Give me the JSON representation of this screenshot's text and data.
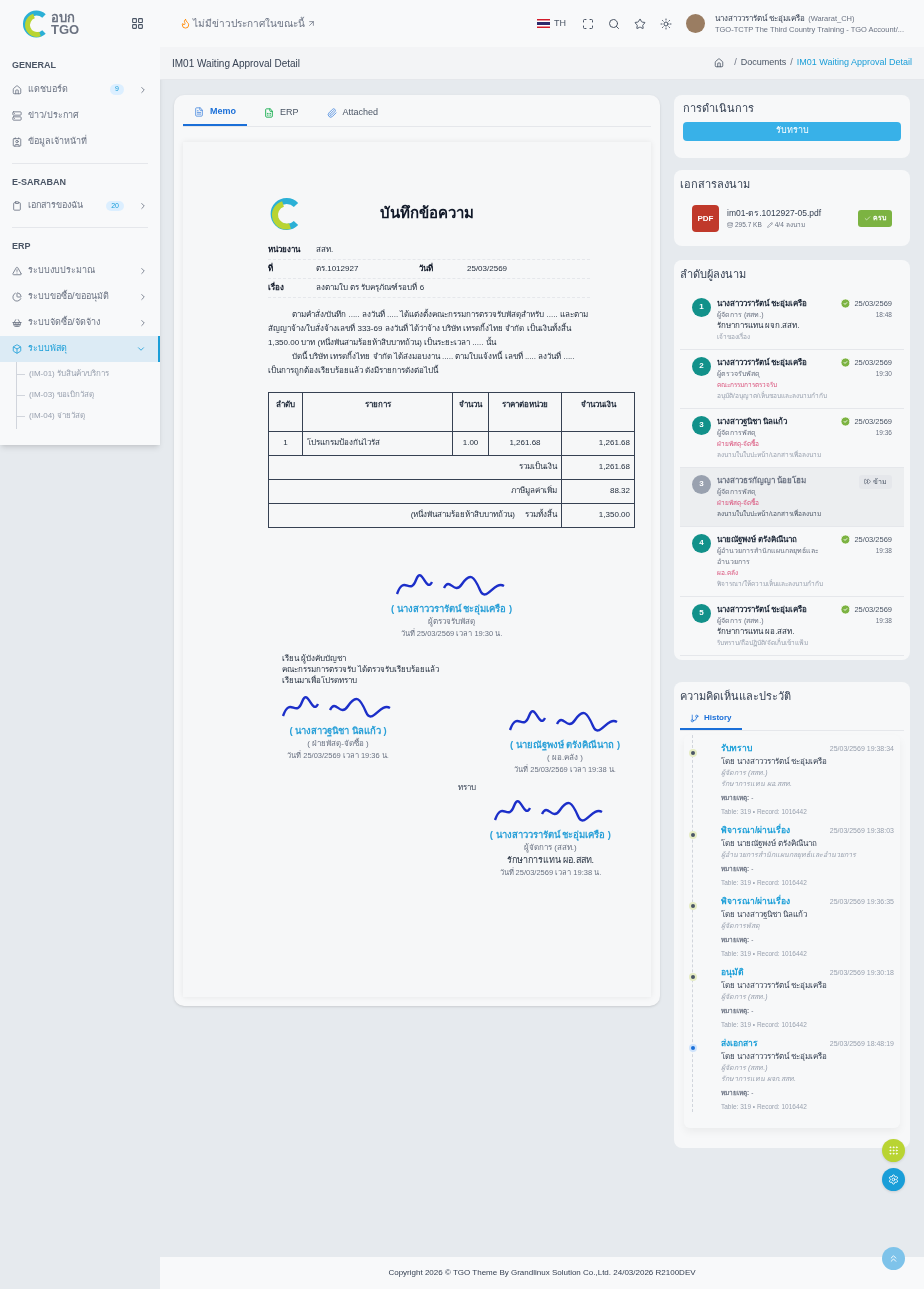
{
  "logo": {
    "line1": "อบก",
    "line2": "TGO"
  },
  "header": {
    "news": "ไม่มีข่าวประกาศในขณะนี้",
    "language": "TH",
    "user": {
      "name": "นางสาววรารัตน์ ชะอุ่มเครือ",
      "username": "(Wararat_CH)",
      "org": "TGO-TCTP The Third Country Training - TGO Account/..."
    }
  },
  "sidebar": {
    "sections": [
      {
        "title": "GENERAL",
        "items": [
          {
            "label": "แดชบอร์ด",
            "badge": "9",
            "expanded": false,
            "selected": false
          },
          {
            "label": "ข่าว/ประกาศ",
            "selected": false
          },
          {
            "label": "ข้อมูลเจ้าหน้าที่",
            "selected": false
          }
        ]
      },
      {
        "title": "E-SARABAN",
        "items": [
          {
            "label": "เอกสารของฉัน",
            "badge": "20",
            "expanded": false,
            "selected": false
          }
        ]
      },
      {
        "title": "ERP",
        "items": [
          {
            "label": "ระบบงบประมาณ",
            "expanded": false,
            "selected": false
          },
          {
            "label": "ระบบขอซื้อ/ขออนุมัติ",
            "expanded": false,
            "selected": false
          },
          {
            "label": "ระบบจัดซื้อ/จัดจ้าง",
            "expanded": false,
            "selected": false
          },
          {
            "label": "ระบบพัสดุ",
            "expanded": true,
            "selected": true,
            "children": [
              {
                "label": "(IM-01) รับสินค้า/บริการ"
              },
              {
                "label": "(IM-03) ขอเบิกวัสดุ"
              },
              {
                "label": "(IM-04) จ่ายวัสดุ"
              }
            ]
          }
        ]
      }
    ]
  },
  "page": {
    "title": "IM01 Waiting Approval Detail",
    "separator": "/",
    "breadcrumb": [
      {
        "label": "Documents",
        "current": false
      },
      {
        "label": "IM01 Waiting Approval Detail",
        "current": true
      }
    ]
  },
  "tabs": [
    {
      "label": "Memo",
      "selected": true
    },
    {
      "label": "ERP",
      "selected": false
    },
    {
      "label": "Attached",
      "selected": false
    }
  ],
  "memo": {
    "title": "บันทึกข้อความ",
    "fields": [
      {
        "label": "หน่วยงาน",
        "value": "สสท."
      },
      {
        "label": "ที่",
        "value": "ตร.1012927",
        "label2": "วันที่",
        "value2": "25/03/2569"
      },
      {
        "label": "เรื่อง",
        "value": "ลงตามใบ ตร รับครุภัณฑ์รอบที่ 6"
      }
    ],
    "paragraphs": [
      "ตามคำสั่ง/บันทึก ..... ลงวันที่ ..... ได้แต่งตั้งคณะกรรมการตรวจรับพัสดุสำหรับ ..... และตามสัญญาจ้าง/ใบสั่งจ้างเลขที่ 333-69 ลงวันที่ ได้ว่าจ้าง บริษัท เทรดกิ้งไทย จำกัด เป็นเงินทั้งสิ้น 1,350.00 บาท (หนึ่งพันสามร้อยห้าสิบบาทถ้วน) เป็นระยะเวลา ..... นั้น",
      "บัดนี้ บริษัท เทรดกิ้งไทย จำกัด ได้ส่งมอบงาน ..... ตามใบแจ้งหนี้ เลขที่ ..... ลงวันที่ ..... เป็นการถูกต้องเรียบร้อยแล้ว ดังมีรายการดังต่อไปนี้"
    ],
    "table": {
      "columns": [
        "ลำดับ",
        "รายการ",
        "จำนวน",
        "ราคาต่อหน่วย",
        "จำนวนเงิน"
      ],
      "rows": [
        [
          "1",
          "โปรแกรมป้องกันไวรัส",
          "1.00",
          "1,261.68",
          "1,261.68"
        ]
      ],
      "totals": [
        {
          "label": "รวมเป็นเงิน",
          "value": "1,261.68"
        },
        {
          "label": "ภาษีมูลค่าเพิ่ม",
          "value": "88.32"
        },
        {
          "words": "(หนึ่งพันสามร้อยห้าสิบบาทถ้วน)",
          "label": "รวมทั้งสิ้น",
          "value": "1,350.00"
        }
      ]
    },
    "signature1": {
      "name": "( นางสาววรารัตน์ ชะอุ่มเครือ )",
      "role": "ผู้ตรวจรับพัสดุ",
      "date": "วันที่ 25/03/2569 เวลา 19:30 น."
    },
    "letter": [
      "เรียน ผู้บังคับบัญชา",
      "คณะกรรมการตรวจรับ ได้ตรวจรับเรียบร้อยแล้ว",
      "เรียนมาเพื่อโปรดทราบ"
    ],
    "signature2": {
      "name": "( นางสาวฐนิชา นิลแก้ว )",
      "role": "( ฝ่ายพัสดุ-จัดซื้อ )",
      "date": "วันที่ 25/03/2569 เวลา 19:36 น."
    },
    "signature3": {
      "name": "( นายณัฐพงษ์ ตรังคิณีนาถ )",
      "role": "( ผอ.คลัง )",
      "date": "วันที่ 25/03/2569 เวลา 19:38 น."
    },
    "acknowledge": "ทราบ",
    "signature4": {
      "name": "( นางสาววรารัตน์ ชะอุ่มเครือ )",
      "role": "ผู้จัดการ (สสท.)",
      "acting": "รักษาการแทน ผอ.สสท.",
      "date": "วันที่ 25/03/2569 เวลา 19:38 น."
    }
  },
  "actions": {
    "title": "การดำเนินการ",
    "button": "รับทราบ"
  },
  "signed_document": {
    "title": "เอกสารลงนาม",
    "file_type": "PDF",
    "file_name": "im01-ตร.1012927-05.pdf",
    "size": "295.7 KB",
    "signatures": "4/4 ลงนาม",
    "status": "ครบ"
  },
  "signers": {
    "title": "ลำดับผู้ลงนาม",
    "items": [
      {
        "kind": "done",
        "number": "1",
        "name": "นางสาววรารัตน์ ชะอุ่มเครือ",
        "position": "ผู้จัดการ (สสท.)",
        "acting": "รักษาการแทน ผจก.สสท.",
        "duty": "เจ้าของเรื่อง",
        "date": "25/03/2569",
        "time": "18:48"
      },
      {
        "kind": "done",
        "number": "2",
        "name": "นางสาววรารัตน์ ชะอุ่มเครือ",
        "position": "ผู้ตรวจรับพัสดุ",
        "unit": "คณะกรรมการตรวจรับ",
        "duty": "อนุมัติ/อนุญาต/เห็นชอบและลงนามกำกับ",
        "date": "25/03/2569",
        "time": "19:30"
      },
      {
        "kind": "done",
        "number": "3",
        "name": "นางสาวฐนิชา นิลแก้ว",
        "position": "ผู้จัดการพัสดุ",
        "unit": "ฝ่ายพัสดุ-จัดซื้อ",
        "duty": "ลงนามในใบปะหน้า/เอกสารเพื่อลงนาม",
        "date": "25/03/2569",
        "time": "19:36"
      },
      {
        "kind": "skipped",
        "number": "3",
        "name": "นางสาวธรกัญญา น้อยโฮม",
        "position": "ผู้จัดการพัสดุ",
        "unit": "ฝ่ายพัสดุ-จัดซื้อ",
        "duty": "ลงนามในใบปะหน้า/เอกสารเพื่อลงนาม",
        "badge": "ข้าม"
      },
      {
        "kind": "done",
        "number": "4",
        "name": "นายณัฐพงษ์ ตรังคิณีนาถ",
        "position": "ผู้อำนวยการสำนักแผนกลยุทธ์และอำนวยการ",
        "unit": "ผอ.คลัง",
        "duty": "พิจารณา/ให้ความเห็นและลงนามกำกับ",
        "date": "25/03/2569",
        "time": "19:38"
      },
      {
        "kind": "done",
        "number": "5",
        "name": "นางสาววรารัตน์ ชะอุ่มเครือ",
        "position": "ผู้จัดการ (สสท.)",
        "acting": "รักษาการแทน ผอ.สสท.",
        "duty": "รับทราบ/ถือปฏิบัติ/จัดเก็บเข้าแฟ้ม",
        "date": "25/03/2569",
        "time": "19:38"
      }
    ]
  },
  "comments": {
    "title": "ความคิดเห็นและประวัติ",
    "tab": {
      "label": "History",
      "selected": true
    },
    "items": [
      {
        "action": "รับทราบ",
        "datetime": "25/03/2569 19:38:34",
        "by": "โดย นางสาววรารัตน์ ชะอุ่มเครือ",
        "roles": [
          "ผู้จัดการ (สสท.)",
          "รักษาการแทน ผอ.สสท."
        ],
        "note_label": "หมายเหตุ:",
        "note": "-",
        "meta": "Table: 319 • Record: 1016442",
        "current": false
      },
      {
        "action": "พิจารณา/ผ่านเรื่อง",
        "datetime": "25/03/2569 19:38:03",
        "by": "โดย นายณัฐพงษ์ ตรังคิณีนาถ",
        "roles": [
          "ผู้อำนวยการสำนักแผนกลยุทธ์และอำนวยการ"
        ],
        "note_label": "หมายเหตุ:",
        "note": "-",
        "meta": "Table: 319 • Record: 1016442",
        "current": false
      },
      {
        "action": "พิจารณา/ผ่านเรื่อง",
        "datetime": "25/03/2569 19:36:35",
        "by": "โดย นางสาวฐนิชา นิลแก้ว",
        "roles": [
          "ผู้จัดการพัสดุ"
        ],
        "note_label": "หมายเหตุ:",
        "note": "-",
        "meta": "Table: 319 • Record: 1016442",
        "current": false
      },
      {
        "action": "อนุมัติ",
        "datetime": "25/03/2569 19:30:18",
        "by": "โดย นางสาววรารัตน์ ชะอุ่มเครือ",
        "roles": [
          "ผู้จัดการ (สสท.)"
        ],
        "note_label": "หมายเหตุ:",
        "note": "-",
        "meta": "Table: 319 • Record: 1016442",
        "current": false
      },
      {
        "action": "ส่งเอกสาร",
        "datetime": "25/03/2569 18:48:19",
        "by": "โดย นางสาววรารัตน์ ชะอุ่มเครือ",
        "roles": [
          "ผู้จัดการ (สสท.)",
          "รักษาการแทน ผจก.สสท."
        ],
        "note_label": "หมายเหตุ:",
        "note": "-",
        "meta": "Table: 319 • Record: 1016442",
        "current": true
      }
    ]
  },
  "footer": "Copyright 2026 © TGO Theme By Grandlinux Solution Co.,Ltd. 24/03/2026 R2100DEV"
}
